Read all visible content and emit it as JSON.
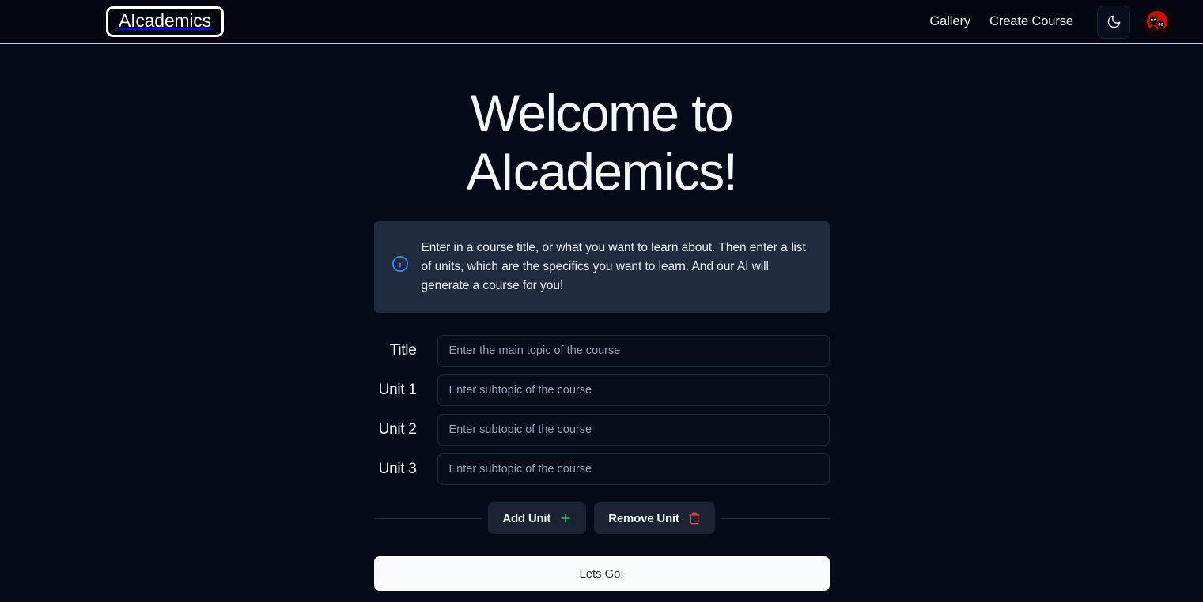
{
  "header": {
    "logo": "AIcademics",
    "nav_links": [
      {
        "label": "Gallery"
      },
      {
        "label": "Create Course"
      }
    ],
    "theme_toggle": {
      "icon": "moon-icon"
    },
    "avatar": {
      "icon": "user-avatar",
      "background_color": "#b31212"
    }
  },
  "hero": {
    "title_line1": "Welcome to",
    "title_line2": "AIcademics!"
  },
  "alert": {
    "icon": "info-circle-icon",
    "icon_color": "#3b82f6",
    "background_color": "#1f2c3f",
    "text": "Enter in a course title, or what you want to learn about. Then enter a list of units, which are the specifics you want to learn. And our AI will generate a course for you!"
  },
  "form": {
    "fields": [
      {
        "label": "Title",
        "placeholder": "Enter the main topic of the course",
        "value": ""
      },
      {
        "label": "Unit 1",
        "placeholder": "Enter subtopic of the course",
        "value": ""
      },
      {
        "label": "Unit 2",
        "placeholder": "Enter subtopic of the course",
        "value": ""
      },
      {
        "label": "Unit 3",
        "placeholder": "Enter subtopic of the course",
        "value": ""
      }
    ]
  },
  "actions": {
    "add_unit_label": "Add Unit",
    "add_unit_icon": "plus-icon",
    "add_unit_icon_color": "#3cb878",
    "remove_unit_label": "Remove Unit",
    "remove_unit_icon": "trash-icon",
    "remove_unit_icon_color": "#e8453c",
    "submit_label": "Lets Go!"
  },
  "theme": {
    "page_background": "#050b18",
    "header_background": "#03070f",
    "input_background": "#070d1b",
    "button_background": "#1b2432",
    "submit_background": "#f8f9fa"
  }
}
